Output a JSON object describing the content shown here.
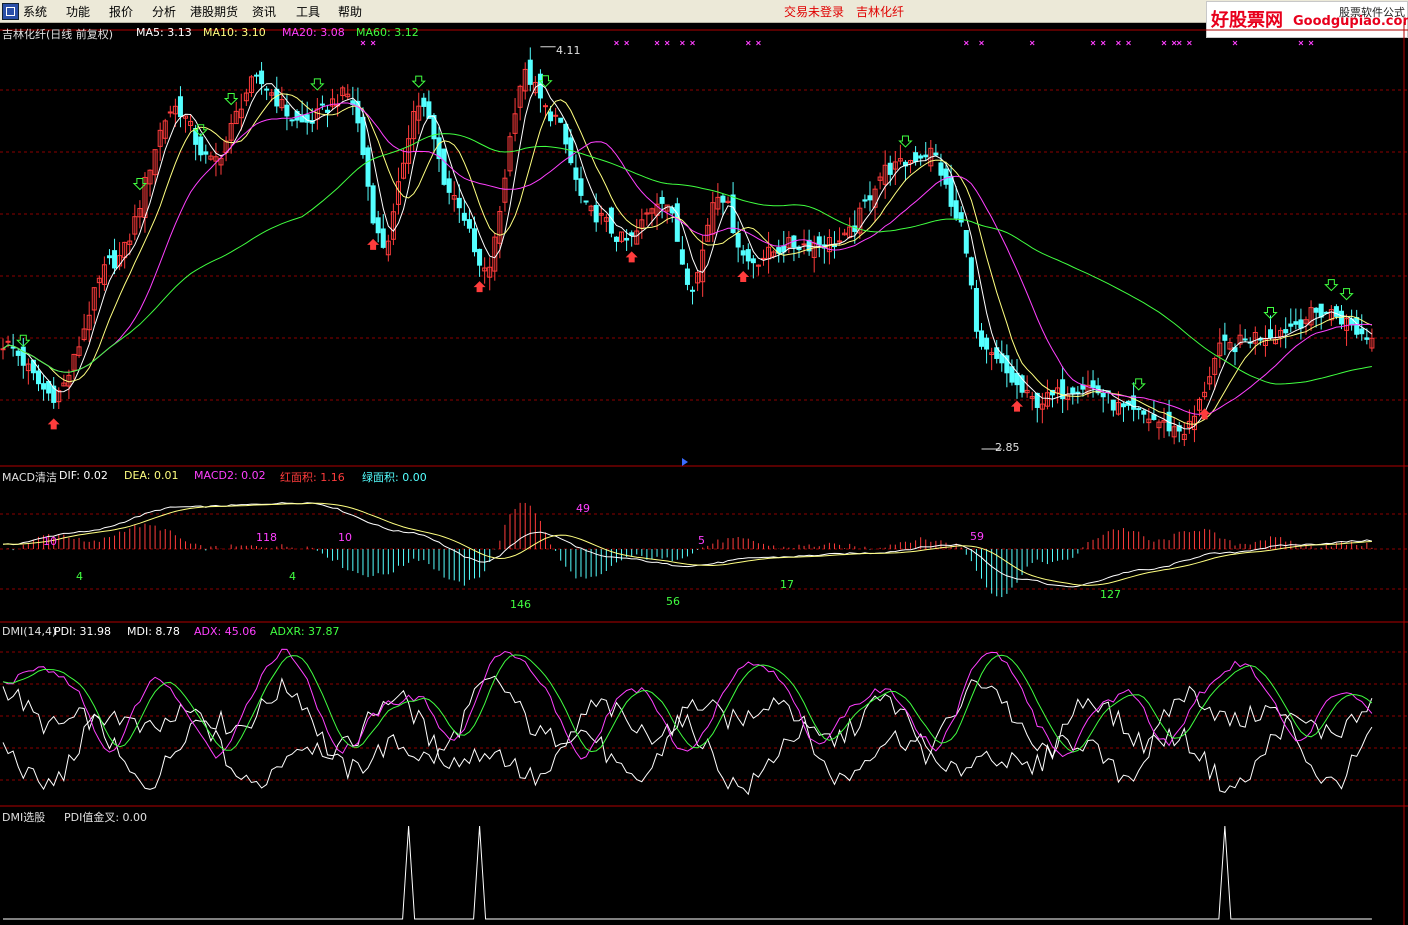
{
  "menu": {
    "items": [
      "系统",
      "功能",
      "报价",
      "分析",
      "港股期货",
      "资讯",
      "工具",
      "帮助"
    ],
    "status": "交易未登录",
    "stock_name": "吉林化纤"
  },
  "brand": {
    "main": "好股票网",
    "url": "Goodgupiao.com",
    "sub": "股票软件公式"
  },
  "colors": {
    "background": "#000000",
    "grid": "#8b0000",
    "up": "#ff3c3c",
    "down": "#54ffff",
    "ma5": "#ffffff",
    "ma10": "#ffff80",
    "ma20": "#ff40ff",
    "ma60": "#40ff40"
  },
  "panels": {
    "price": {
      "title": "吉林化纤(日线 前复权)",
      "ma5": "MA5: 3.13",
      "ma10": "MA10: 3.10",
      "ma20": "MA20: 3.08",
      "ma60": "MA60: 3.12",
      "high_label": "4.11",
      "low_label": "2.85"
    },
    "macd": {
      "title": "MACD清洁",
      "dif": "DIF: 0.02",
      "dea": "DEA: 0.01",
      "macd2": "MACD2: 0.02",
      "red_area": "红面积: 1.16",
      "green_area": "绿面积: 0.00",
      "labels_red": [
        "10",
        "118",
        "10",
        "49",
        "5",
        "59"
      ],
      "labels_green": [
        "4",
        "4",
        "146",
        "56",
        "17",
        "127"
      ]
    },
    "dmi": {
      "title": "DMI(14,4)",
      "pdi": "PDI: 31.98",
      "mdi": "MDI: 8.78",
      "adx": "ADX: 45.06",
      "adxr": "ADXR: 37.87"
    },
    "dmi_select": {
      "title": "DMI选股",
      "value": "PDI值金叉: 0.00"
    }
  },
  "chart_data": [
    {
      "type": "candlestick",
      "title": "吉林化纤(日线 前复权)",
      "ylim": [
        2.8,
        4.15
      ],
      "marked_high": 4.11,
      "marked_low": 2.85,
      "anchors": [
        [
          0,
          3.18
        ],
        [
          10,
          3.02
        ],
        [
          22,
          3.44
        ],
        [
          34,
          3.92
        ],
        [
          41,
          3.75
        ],
        [
          50,
          4.0
        ],
        [
          59,
          3.87
        ],
        [
          68,
          3.96
        ],
        [
          75,
          3.49
        ],
        [
          82,
          3.93
        ],
        [
          89,
          3.64
        ],
        [
          95,
          3.4
        ],
        [
          103,
          4.02
        ],
        [
          108,
          3.9
        ],
        [
          116,
          3.59
        ],
        [
          123,
          3.5
        ],
        [
          130,
          3.64
        ],
        [
          136,
          3.37
        ],
        [
          141,
          3.66
        ],
        [
          147,
          3.44
        ],
        [
          156,
          3.49
        ],
        [
          165,
          3.5
        ],
        [
          175,
          3.73
        ],
        [
          183,
          3.78
        ],
        [
          189,
          3.55
        ],
        [
          193,
          3.15
        ],
        [
          204,
          3.0
        ],
        [
          213,
          3.05
        ],
        [
          223,
          2.96
        ],
        [
          233,
          2.91
        ],
        [
          241,
          3.17
        ],
        [
          249,
          3.21
        ],
        [
          261,
          3.28
        ],
        [
          270,
          3.2
        ]
      ],
      "ma": [
        "MA5",
        "MA10",
        "MA20",
        "MA60"
      ]
    },
    {
      "type": "bar",
      "title": "MACD清洁",
      "series": [
        "DIF",
        "DEA",
        "MACD2"
      ],
      "anchors": [
        [
          0,
          0.01
        ],
        [
          15,
          0.04
        ],
        [
          35,
          0.1
        ],
        [
          60,
          0.11
        ],
        [
          80,
          0.04
        ],
        [
          95,
          -0.03
        ],
        [
          105,
          0.04
        ],
        [
          120,
          -0.02
        ],
        [
          135,
          -0.04
        ],
        [
          150,
          -0.02
        ],
        [
          170,
          -0.01
        ],
        [
          188,
          0.01
        ],
        [
          200,
          -0.07
        ],
        [
          210,
          -0.09
        ],
        [
          225,
          -0.05
        ],
        [
          240,
          -0.01
        ],
        [
          255,
          0.01
        ],
        [
          270,
          0.02
        ]
      ]
    },
    {
      "type": "line",
      "title": "DMI(14,4)",
      "series": [
        "PDI",
        "MDI",
        "ADX",
        "ADXR"
      ],
      "final": {
        "PDI": 31.98,
        "MDI": 8.78,
        "ADX": 45.06,
        "ADXR": 37.87
      }
    },
    {
      "type": "line",
      "title": "DMI选股",
      "series": [
        "PDI值金叉"
      ],
      "spikes_at_bar": [
        80,
        94,
        241
      ]
    }
  ]
}
